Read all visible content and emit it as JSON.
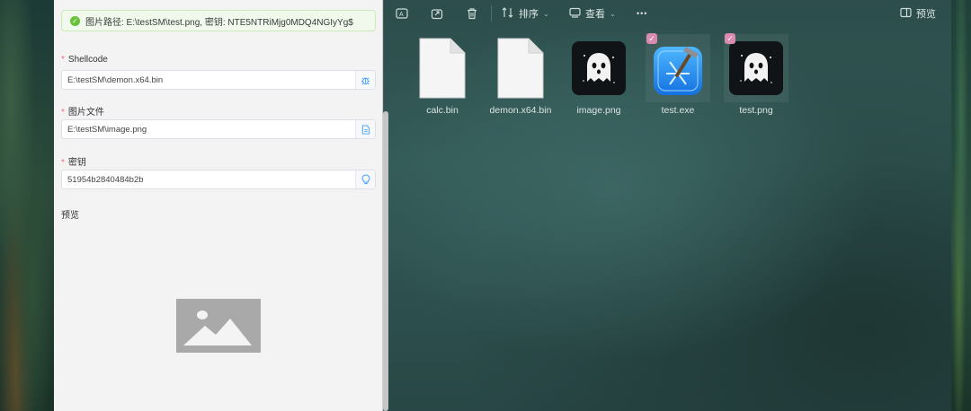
{
  "panel": {
    "alert_text": "图片路径: E:\\testSM\\test.png, 密钥: NTE5NTRiMjg0MDQ4NGIyYg$",
    "shellcode": {
      "label": "Shellcode",
      "value": "E:\\testSM\\demon.x64.bin",
      "icon": "bug-icon"
    },
    "image_file": {
      "label": "图片文件",
      "value": "E:\\testSM\\image.png",
      "icon": "document-icon"
    },
    "key": {
      "label": "密钥",
      "value": "51954b2840484b2b",
      "icon": "lightbulb-icon"
    },
    "preview_label": "预览",
    "required_mark": "*"
  },
  "toolbar": {
    "sort_label": "排序",
    "view_label": "查看",
    "more_label": "•••",
    "preview_label": "预览"
  },
  "files": [
    {
      "name": "calc.bin",
      "type": "blank-file",
      "selected": false
    },
    {
      "name": "demon.x64.bin",
      "type": "blank-file",
      "selected": false
    },
    {
      "name": "image.png",
      "type": "ghost-image",
      "selected": false
    },
    {
      "name": "test.exe",
      "type": "xcode-app",
      "selected": true
    },
    {
      "name": "test.png",
      "type": "ghost-image",
      "selected": true
    }
  ],
  "colors": {
    "success_green": "#67c23a",
    "required_red": "#f56c6c",
    "selection_pink": "#d88ab0",
    "accent_blue": "#409eff"
  }
}
